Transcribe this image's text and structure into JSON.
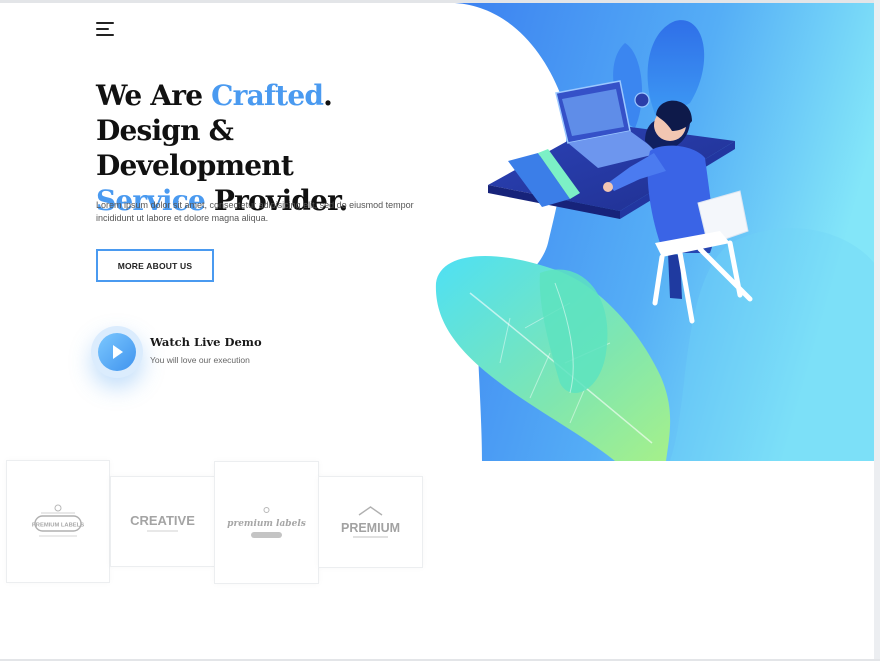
{
  "header": {
    "menu_icon": "hamburger-menu-icon"
  },
  "hero": {
    "headline": {
      "line1_prefix": "We Are ",
      "line1_accent": "Crafted",
      "line1_suffix": ".",
      "line2": "Design & Development",
      "line3_accent": "Service",
      "line3_suffix": " Provider."
    },
    "intro": "Lorem ipsum dolor sit amet, consectetur adipisicing elit, sed do eiusmod tempor incididunt ut labore et dolore magna aliqua.",
    "cta_label": "More About Us",
    "demo": {
      "title": "Watch Live Demo",
      "subtitle": "You will love our execution",
      "icon": "play-icon"
    },
    "illustration": "isometric-developer-at-desk-illustration"
  },
  "brands": [
    {
      "name": "premium-labels-logo",
      "text": "PREMIUM LABELS"
    },
    {
      "name": "creative-logo",
      "text": "CREATIVE"
    },
    {
      "name": "premium-labels-script-logo",
      "text": "premium labels"
    },
    {
      "name": "premium-logo",
      "text": "PREMIUM"
    }
  ],
  "colors": {
    "accent": "#4a9af0",
    "heading": "#111111",
    "body_text": "#555555",
    "hero_gradient_start": "#3a7ef0",
    "hero_gradient_end": "#7fe3f8"
  }
}
